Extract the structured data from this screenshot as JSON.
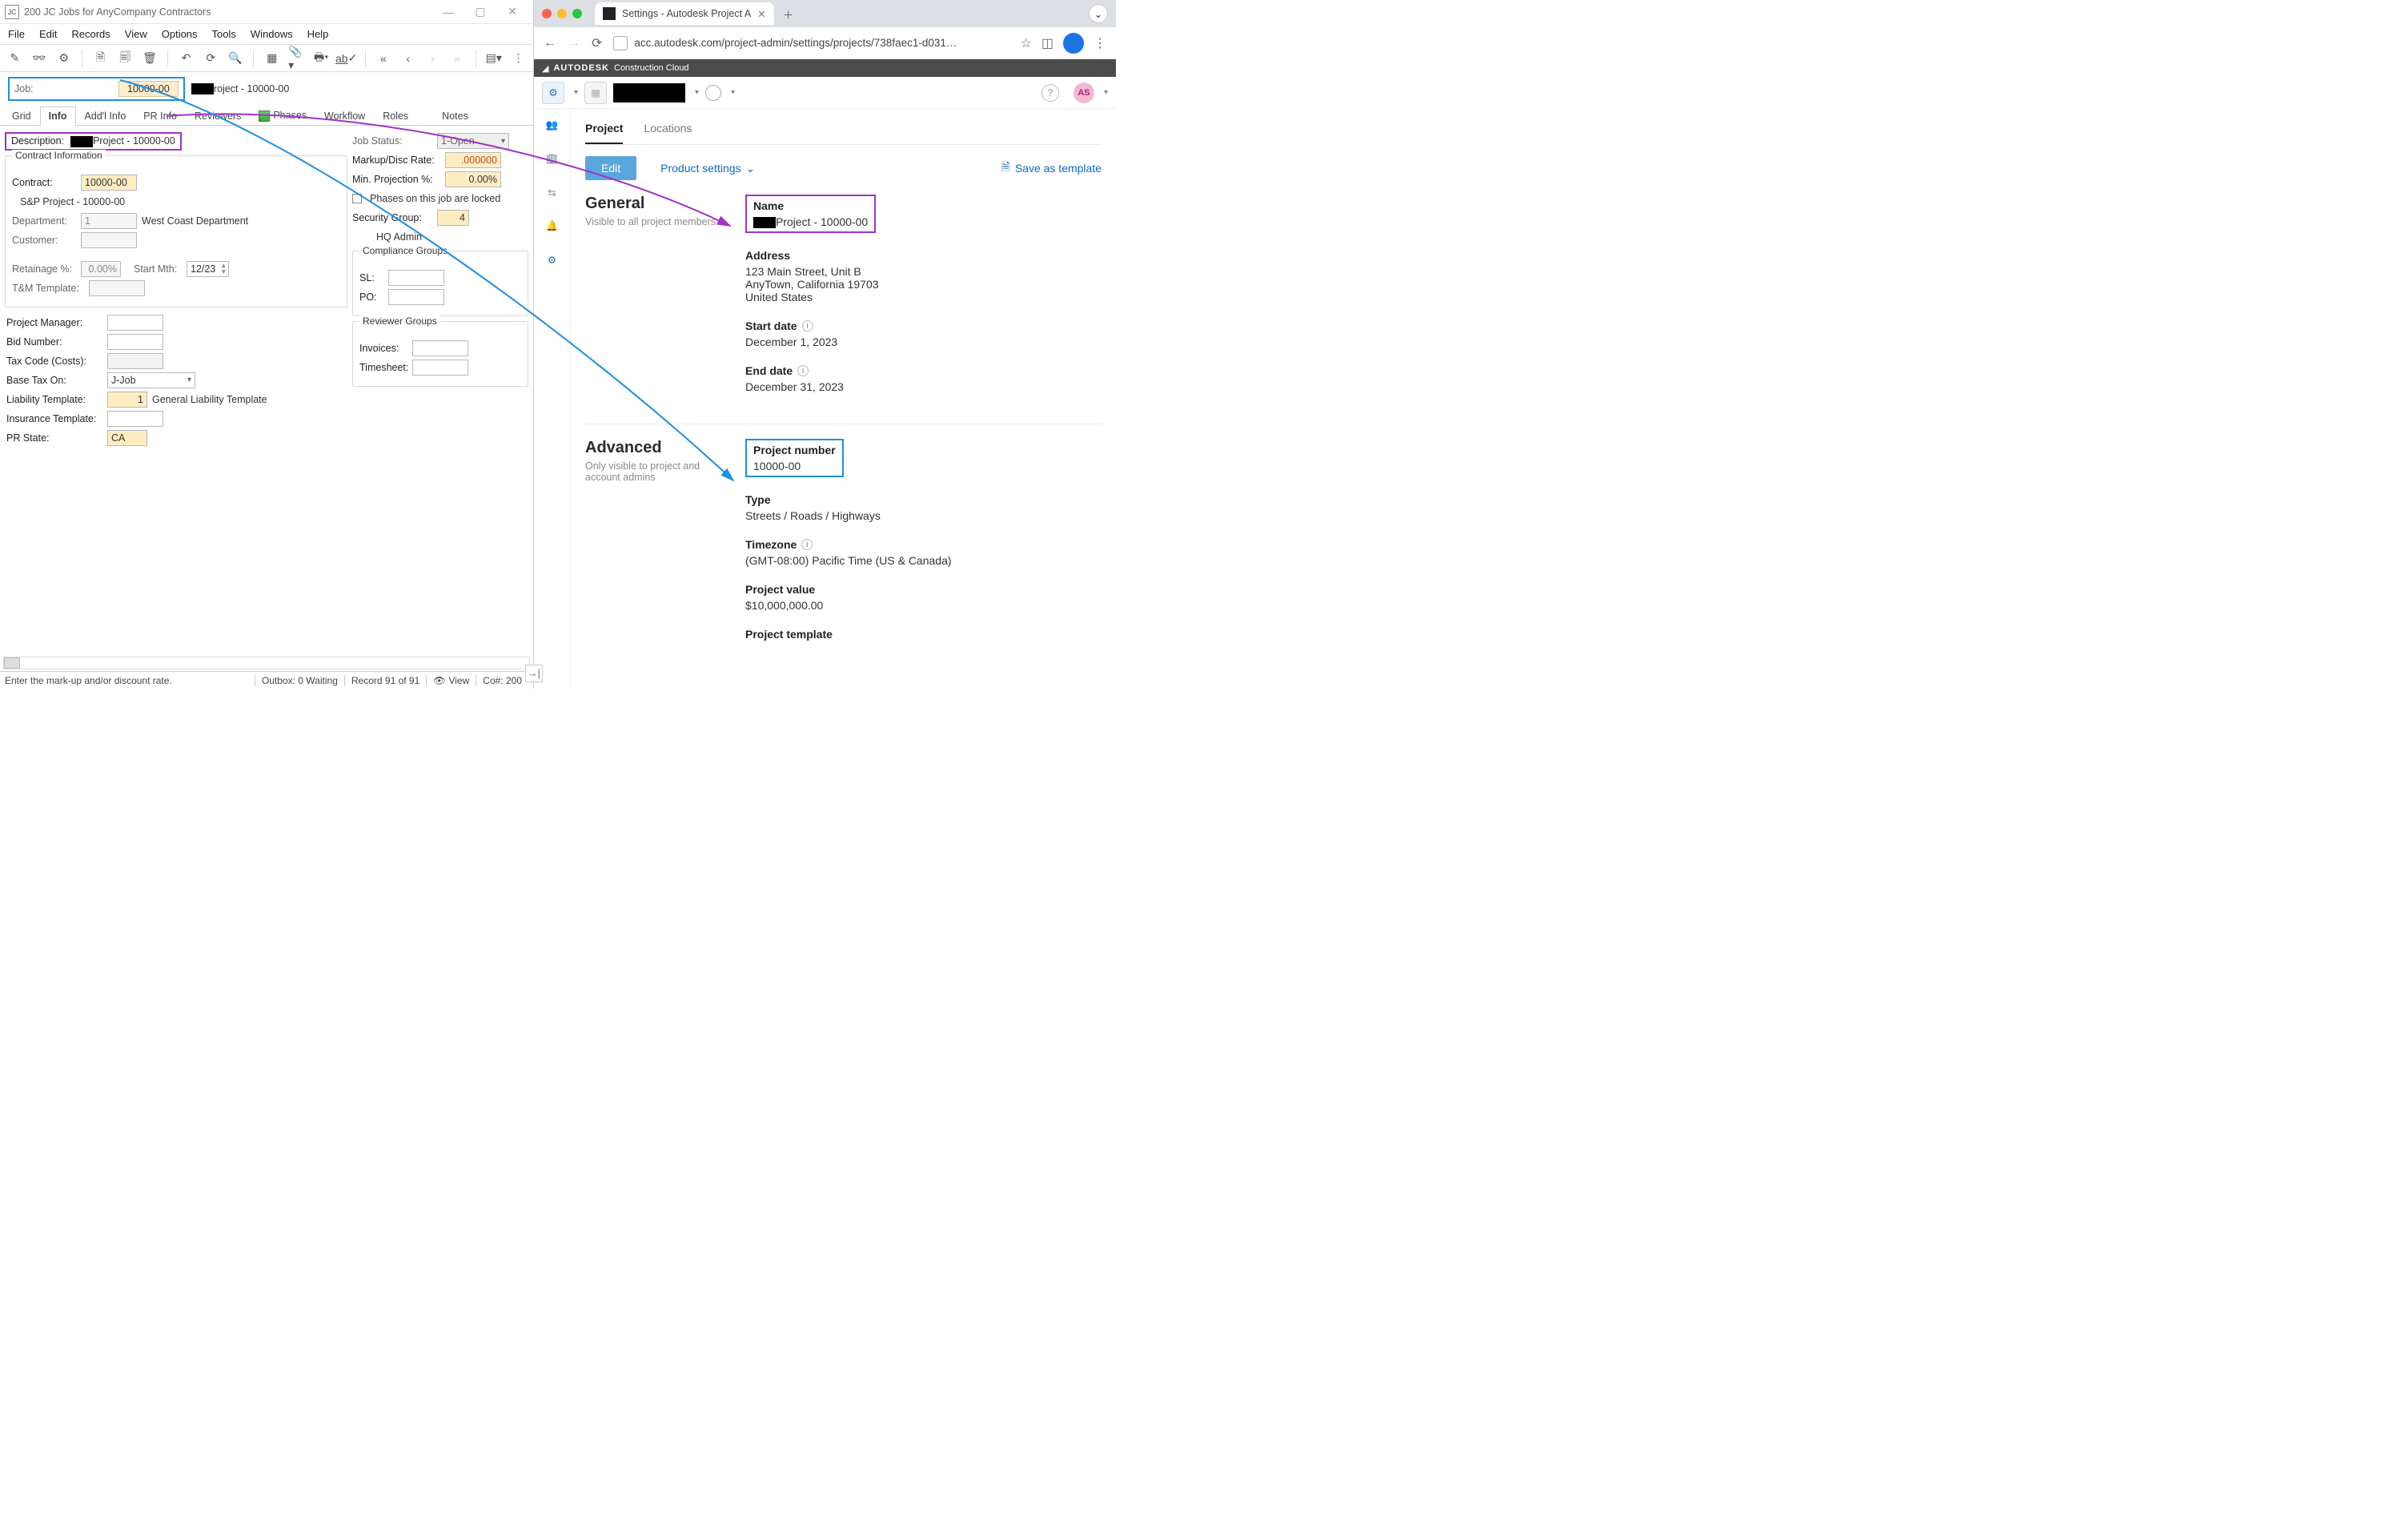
{
  "win": {
    "title": "200 JC Jobs for AnyCompany Contractors",
    "menu": [
      "File",
      "Edit",
      "Records",
      "View",
      "Options",
      "Tools",
      "Windows",
      "Help"
    ],
    "job_label": "Job:",
    "job_value": "10000-00",
    "job_desc_suffix": "roject - 10000-00",
    "tabs": [
      "Grid",
      "Info",
      "Add'l Info",
      "PR Info",
      "Reviewers",
      "Phases",
      "Workflow",
      "Roles",
      "Notes"
    ],
    "active_tab": "Info",
    "description_label": "Description:",
    "description_value": "Project - 10000-00",
    "contract_info_title": "Contract Information",
    "contract_label": "Contract:",
    "contract_value": "10000-00",
    "sp_line": "S&P Project - 10000-00",
    "dept_label": "Department:",
    "dept_value": "1",
    "dept_name": "West Coast Department",
    "customer_label": "Customer:",
    "retainage_label": "Retainage %:",
    "retainage_value": "0.00%",
    "startmth_label": "Start Mth:",
    "startmth_value": "12/23",
    "tm_label": "T&M Template:",
    "pm_label": "Project Manager:",
    "bid_label": "Bid Number:",
    "tax_label": "Tax Code (Costs):",
    "basetax_label": "Base Tax On:",
    "basetax_value": "J-Job",
    "liab_label": "Liability Template:",
    "liab_value": "1",
    "liab_name": "General Liability Template",
    "ins_label": "Insurance Template:",
    "prstate_label": "PR State:",
    "prstate_value": "CA",
    "jobstatus_label": "Job Status:",
    "jobstatus_value": "1-Open",
    "markup_label": "Markup/Disc Rate:",
    "markup_value": ".000000",
    "minproj_label": "Min. Projection %:",
    "minproj_value": "0.00%",
    "phases_locked_label": "Phases on this job are locked",
    "secgrp_label": "Security Group:",
    "secgrp_value": "4",
    "hqadmin": "HQ Admin",
    "compliance_title": "Compliance Groups",
    "sl_label": "SL:",
    "po_label": "PO:",
    "reviewer_title": "Reviewer Groups",
    "inv_label": "Invoices:",
    "ts_label": "Timesheet:",
    "status_msg": "Enter the mark-up and/or discount rate.",
    "outbox": "Outbox: 0 Waiting",
    "record": "Record 91 of 91",
    "viewlabel": "View",
    "co": "Co#: 200"
  },
  "browser": {
    "tab_title": "Settings - Autodesk Project A",
    "url": "acc.autodesk.com/project-admin/settings/projects/738faec1-d031…",
    "brand": "AUTODESK",
    "brand_sub": "Construction Cloud",
    "avatar": "AS",
    "ptabs": [
      "Project",
      "Locations"
    ],
    "active_ptab": "Project",
    "edit": "Edit",
    "product_settings": "Product settings",
    "save_template": "Save as template",
    "general_h": "General",
    "general_sub": "Visible to all project members",
    "name_k": "Name",
    "name_v": "Project - 10000-00",
    "addr_k": "Address",
    "addr_1": "123 Main Street, Unit B",
    "addr_2": "AnyTown, California 19703",
    "addr_3": "United States",
    "start_k": "Start date",
    "start_v": "December 1, 2023",
    "end_k": "End date",
    "end_v": "December 31, 2023",
    "adv_h": "Advanced",
    "adv_sub": "Only visible to project and account admins",
    "num_k": "Project number",
    "num_v": "10000-00",
    "type_k": "Type",
    "type_v": "Streets / Roads / Highways",
    "tz_k": "Timezone",
    "tz_v": "(GMT-08:00) Pacific Time (US & Canada)",
    "pv_k": "Project value",
    "pv_v": "$10,000,000.00",
    "pt_k": "Project template"
  }
}
